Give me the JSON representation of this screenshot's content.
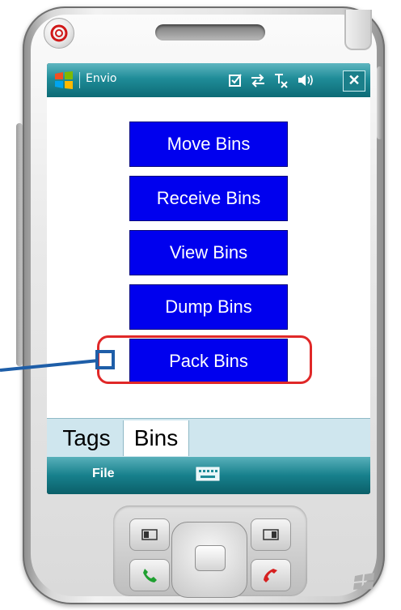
{
  "window": {
    "title": "Envio",
    "close_label": "✕"
  },
  "status_icons": [
    "todo-check-icon",
    "sync-arrows-icon",
    "signal-off-icon",
    "volume-icon"
  ],
  "bins_menu": {
    "buttons": [
      "Move Bins",
      "Receive Bins",
      "View Bins",
      "Dump Bins",
      "Pack Bins"
    ]
  },
  "tabs": [
    {
      "label": "Tags",
      "selected": false
    },
    {
      "label": "Bins",
      "selected": true
    }
  ],
  "softkeys": {
    "left_label": "File"
  },
  "colors": {
    "button_blue": "#0000ee",
    "titlebar_teal": "#1f8c98",
    "highlight_red": "#e02828",
    "callout_blue": "#1e5ea8"
  }
}
